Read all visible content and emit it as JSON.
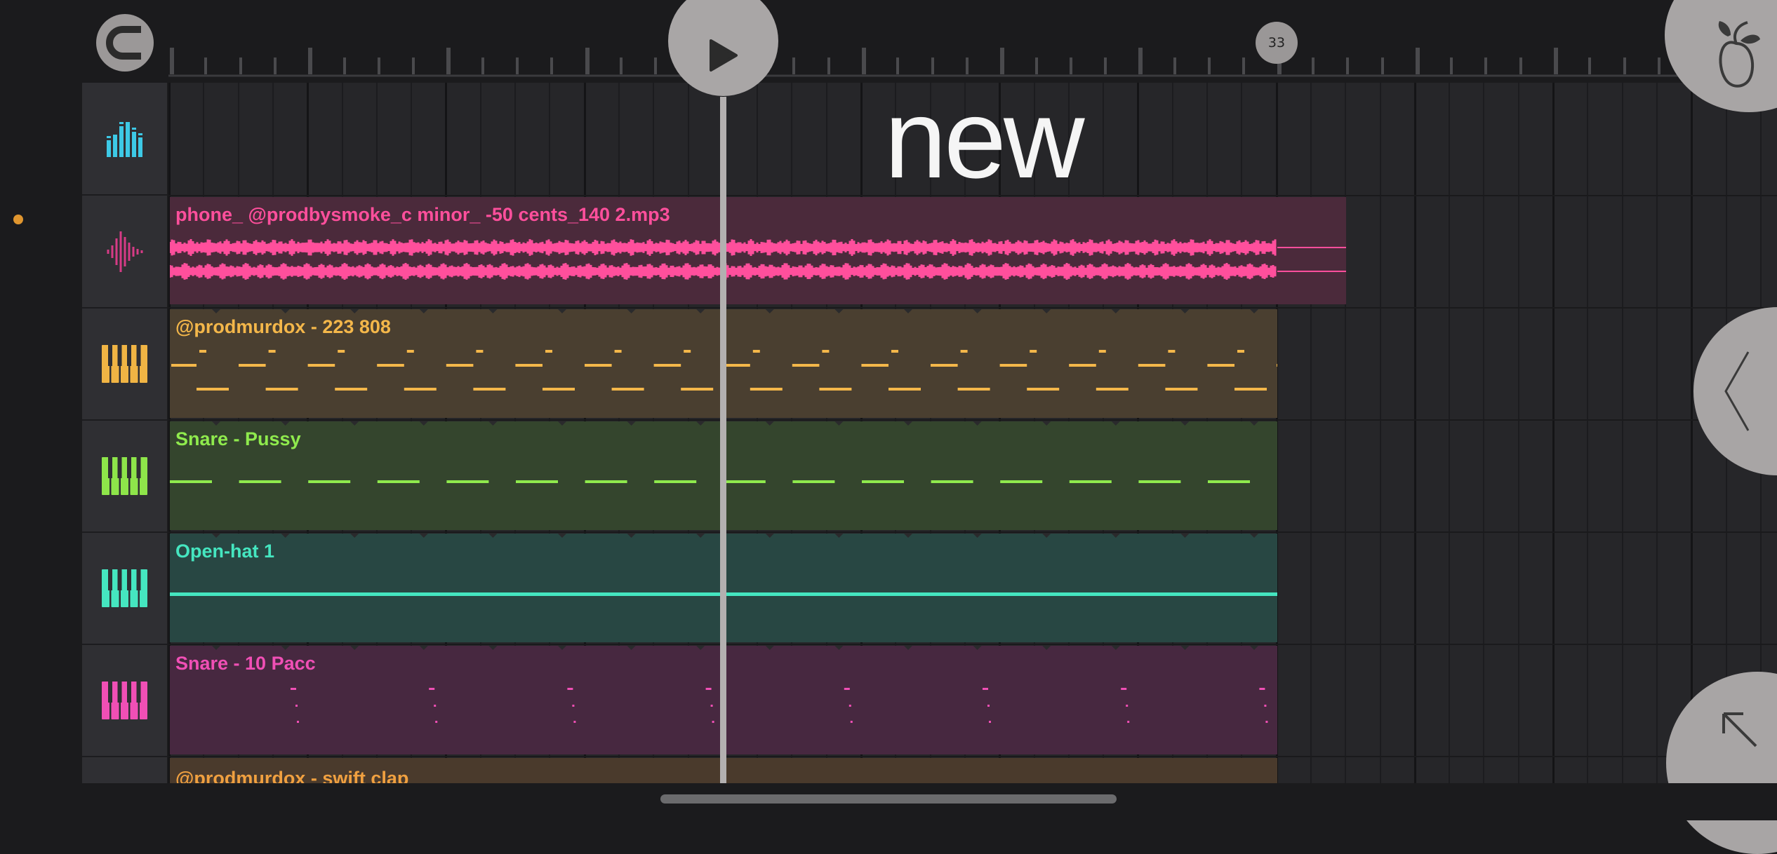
{
  "header": {
    "bar_indicator": "33",
    "title": "new"
  },
  "tracks": [
    {
      "icon": "equalizer-icon",
      "color": "#3dc9e6"
    },
    {
      "icon": "waveform-icon",
      "color": "#d63b86"
    },
    {
      "icon": "piano-keys-icon",
      "color": "#f0b444"
    },
    {
      "icon": "piano-keys-icon",
      "color": "#8ee54a"
    },
    {
      "icon": "piano-keys-icon",
      "color": "#45e6c0"
    },
    {
      "icon": "piano-keys-icon",
      "color": "#f04fb5"
    }
  ],
  "clips": [
    {
      "label": "phone_ @prodbysmoke_c minor_ -50 cents_140 2.mp3",
      "color": "#ff4f9c",
      "bg": "#4b2a3b"
    },
    {
      "label": "@prodmurdox - 223 808",
      "color": "#f4b74a",
      "bg": "#4a3f30"
    },
    {
      "label": "Snare - Pussy",
      "color": "#8fea4d",
      "bg": "#34452d"
    },
    {
      "label": "Open-hat 1",
      "color": "#45e6c0",
      "bg": "#284743"
    },
    {
      "label": "Snare - 10 Pacc",
      "color": "#f04fb5",
      "bg": "#472840"
    },
    {
      "label": "@prodmurdox - swift clap",
      "color": "#f0a040",
      "bg": "#4a3a2c"
    }
  ],
  "icons": {
    "magnet": "magnet-icon",
    "play": "play-icon",
    "logo": "fl-fruit-logo-icon",
    "back": "chevron-left-icon",
    "expand": "arrow-up-left-icon"
  },
  "colors": {
    "accent_dot": "#e0962f",
    "button_gray": "#a8a5a5"
  }
}
